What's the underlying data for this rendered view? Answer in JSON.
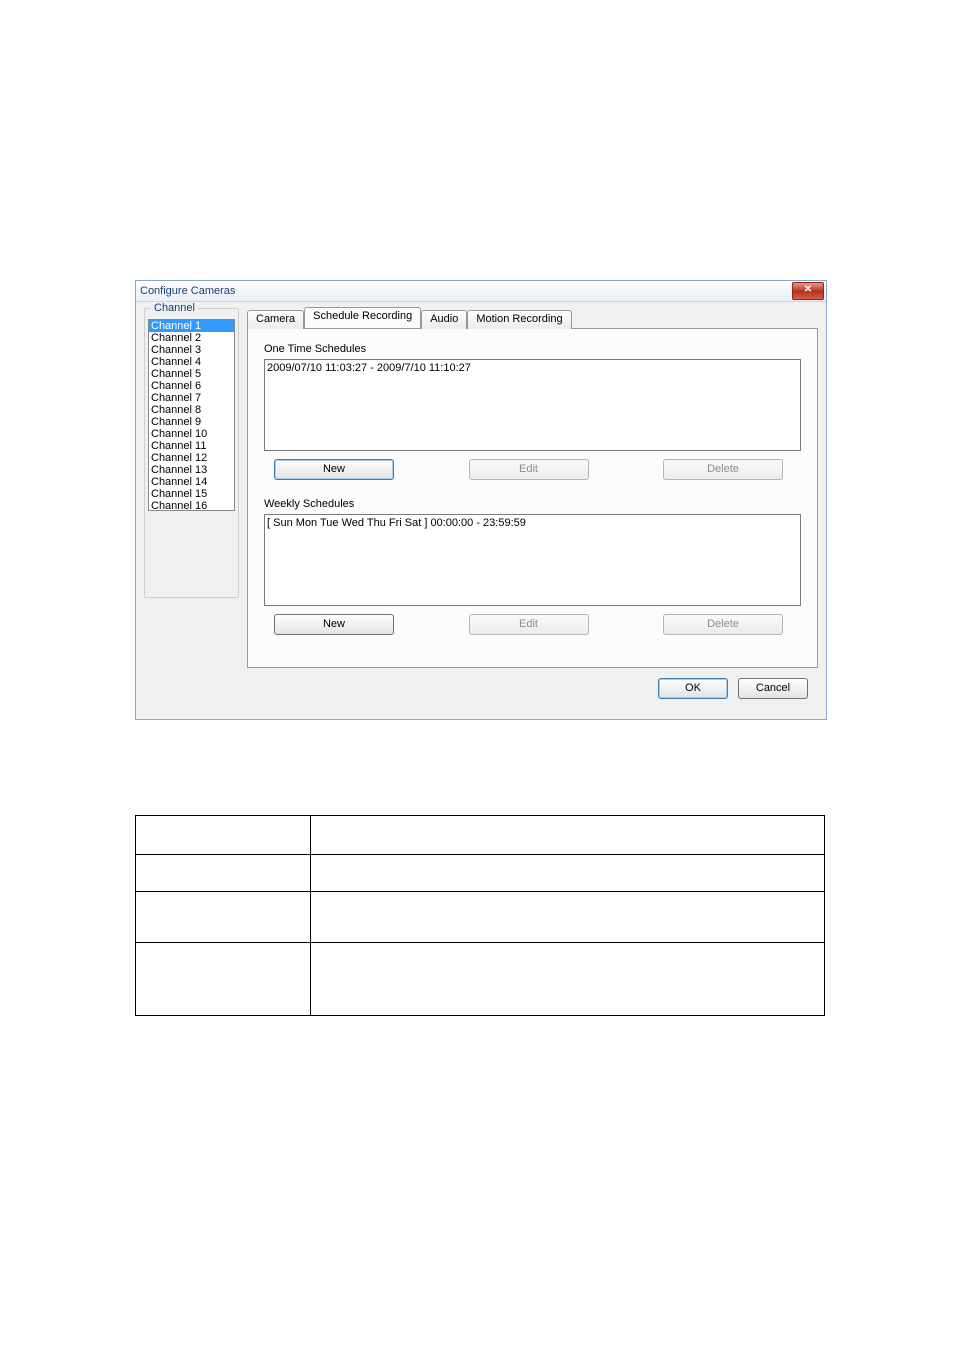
{
  "window": {
    "title": "Configure Cameras",
    "close_glyph": "✕"
  },
  "channel_group": {
    "legend": "Channel",
    "items": [
      "Channel 1",
      "Channel 2",
      "Channel 3",
      "Channel 4",
      "Channel 5",
      "Channel 6",
      "Channel 7",
      "Channel 8",
      "Channel 9",
      "Channel 10",
      "Channel 11",
      "Channel 12",
      "Channel 13",
      "Channel 14",
      "Channel 15",
      "Channel 16"
    ],
    "selected_index": 0
  },
  "tabs": {
    "items": [
      "Camera",
      "Schedule Recording",
      "Audio",
      "Motion Recording"
    ],
    "active_index": 1
  },
  "one_time": {
    "label": "One Time Schedules",
    "entries": [
      "2009/07/10 11:03:27 - 2009/7/10 11:10:27"
    ],
    "buttons": {
      "new": "New",
      "edit": "Edit",
      "delete": "Delete"
    }
  },
  "weekly": {
    "label": "Weekly Schedules",
    "entries": [
      "[ Sun Mon Tue Wed Thu Fri Sat ] 00:00:00 - 23:59:59"
    ],
    "buttons": {
      "new": "New",
      "edit": "Edit",
      "delete": "Delete"
    }
  },
  "footer": {
    "ok": "OK",
    "cancel": "Cancel"
  }
}
